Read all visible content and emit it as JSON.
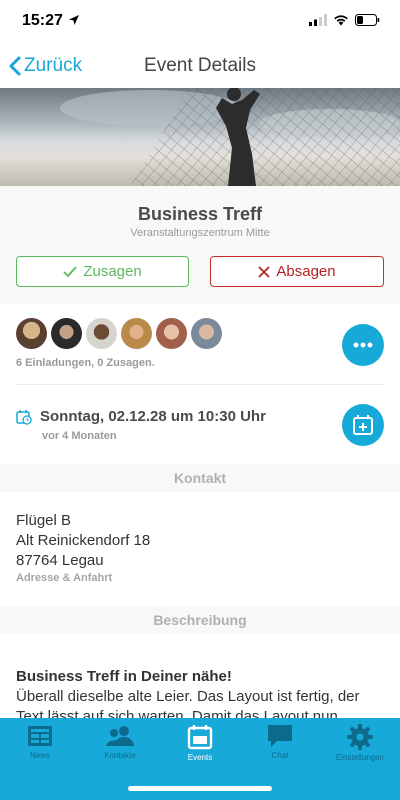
{
  "status": {
    "time": "15:27"
  },
  "nav": {
    "back_label": "Zurück",
    "title": "Event Details"
  },
  "event": {
    "title": "Business Treff",
    "venue": "Veranstaltungszentrum Mitte",
    "accept_label": "Zusagen",
    "decline_label": "Absagen"
  },
  "participants": {
    "invite_summary": "6 Einladungen, 0 Zusagen.",
    "avatar_count": 6
  },
  "schedule": {
    "date": "Sonntag, 02.12.28 um 10:30 Uhr",
    "relative": "vor 4 Monaten"
  },
  "contact": {
    "heading": "Kontakt",
    "lines": [
      "Flügel B",
      "Alt Reinickendorf 18",
      "87764 Legau"
    ],
    "sub": "Adresse & Anfahrt"
  },
  "description": {
    "heading": "Beschreibung",
    "title": "Business Treff in Deiner nähe!",
    "text": "Überall dieselbe alte Leier. Das Layout ist fertig, der Text lässt auf sich warten. Damit das Layout nun"
  },
  "tabs": [
    {
      "label": "News",
      "icon": "news-icon"
    },
    {
      "label": "Kontakte",
      "icon": "contacts-icon"
    },
    {
      "label": "Events",
      "icon": "calendar-icon"
    },
    {
      "label": "Chat",
      "icon": "chat-icon"
    },
    {
      "label": "Einstellungen",
      "icon": "settings-icon"
    }
  ],
  "colors": {
    "accent": "#17a9d8",
    "accept": "#5cb85c",
    "decline": "#b52222"
  }
}
